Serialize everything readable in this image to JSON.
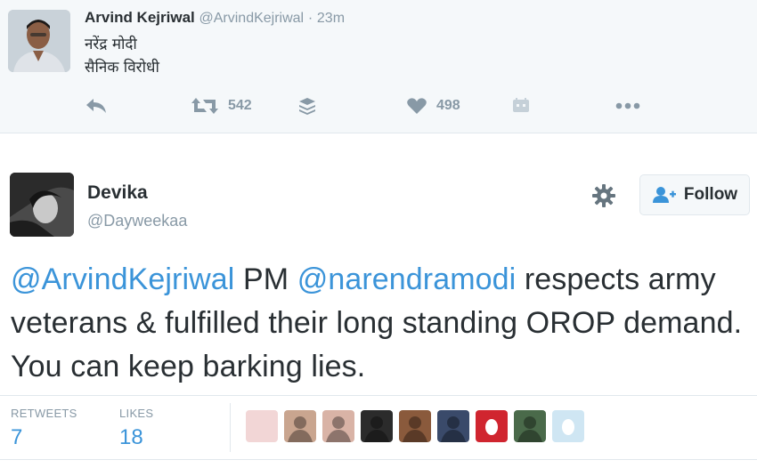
{
  "parent_tweet": {
    "name": "Arvind Kejriwal",
    "handle": "@ArvindKejriwal",
    "separator": "·",
    "time": "23m",
    "lines": [
      "नरेंद्र मोदी",
      "सैनिक विरोधी"
    ],
    "actions": {
      "retweet_count": "542",
      "like_count": "498"
    }
  },
  "main_tweet": {
    "name": "Devika",
    "handle": "@Dayweekaa",
    "follow_label": "Follow",
    "text_parts": {
      "mention1": "@ArvindKejriwal",
      "t1": " PM ",
      "mention2": "@narendramodi",
      "t2": " respects army veterans & fulfilled their long standing OROP demand. You can keep barking lies."
    },
    "stats": {
      "retweets_label": "RETWEETS",
      "retweets_value": "7",
      "likes_label": "LIKES",
      "likes_value": "18"
    },
    "liker_faces": [
      "#f2d6d6",
      "#c9a58f",
      "#d9b3a6",
      "#2b2b2b",
      "#8a5a3c",
      "#3a4a6a",
      "#d0252f",
      "#4a6a4a",
      "#cfe6f3"
    ]
  },
  "colors": {
    "accent": "#3b94d9",
    "muted": "#8899a6",
    "text": "#292f33",
    "parent_bg": "#f5f8fa"
  }
}
